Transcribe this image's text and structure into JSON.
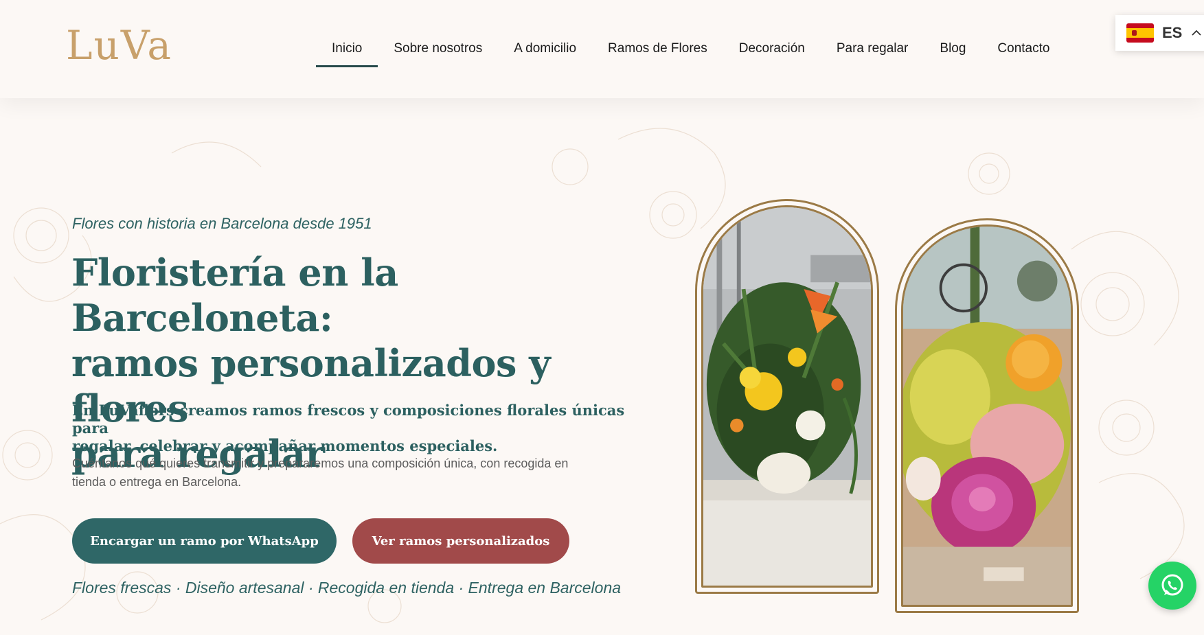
{
  "brand": {
    "logo_text": "LuVa",
    "accent": "#c8a06b"
  },
  "nav": {
    "items": [
      {
        "label": "Inicio",
        "active": true
      },
      {
        "label": "Sobre nosotros"
      },
      {
        "label": "A domicilio"
      },
      {
        "label": "Ramos de Flores"
      },
      {
        "label": "Decoración"
      },
      {
        "label": "Para regalar"
      },
      {
        "label": "Blog"
      },
      {
        "label": "Contacto"
      }
    ]
  },
  "language": {
    "code": "ES",
    "flag_icon": "spain-flag-icon",
    "chevron_icon": "chevron-up-icon"
  },
  "hero": {
    "kicker": "Flores con historia en Barcelona desde 1951",
    "title_line1": "Floristería en la Barceloneta:",
    "title_line2": "ramos personalizados y flores",
    "title_line3": "para regalar",
    "lead_line1": "En LuVaflors creamos ramos frescos y composiciones florales únicas para",
    "lead_line2": "regalar, celebrar y acompañar momentos especiales.",
    "body_line1": "Cuéntanos qué quieres transmitir y prepararemos una composición única, con recogida en",
    "body_line2": "tienda o entrega en Barcelona.",
    "cta_whatsapp": "Encargar un ramo por WhatsApp",
    "cta_ramos": "Ver ramos personalizados",
    "tagline": "Flores frescas · Diseño artesanal · Recogida en tienda · Entrega en Barcelona"
  },
  "colors": {
    "primary_teal": "#2c6060",
    "button_teal": "#2f6767",
    "button_red": "#a14a4a",
    "whatsapp_green": "#25d366",
    "frame_gold": "#9b7a46",
    "background": "#fcf8f5"
  },
  "floating": {
    "whatsapp_icon": "whatsapp-icon"
  }
}
